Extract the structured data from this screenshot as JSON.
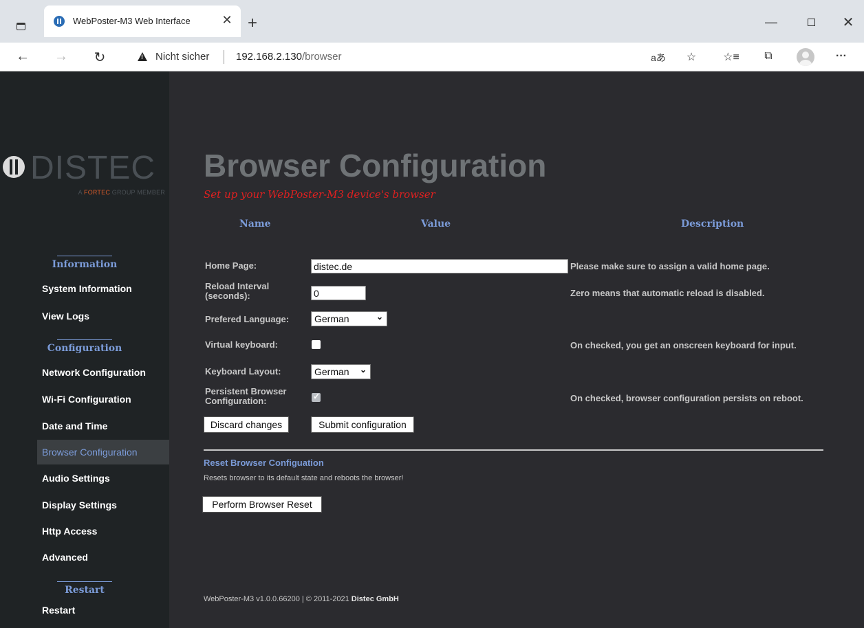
{
  "browser": {
    "tab_title": "WebPoster-M3 Web Interface",
    "tab_close": "✕",
    "new_tab": "+",
    "security_label": "Nicht sicher",
    "url_host": "192.168.2.130",
    "url_path": "/browser",
    "icons": [
      "window-icon",
      "favicon",
      "back-icon",
      "forward-icon",
      "reload-icon",
      "warning-icon",
      "read-aloud-icon",
      "add-favorite-icon",
      "favorites-icon",
      "collections-icon",
      "profile-icon",
      "more-icon",
      "minimize-icon",
      "maximize-icon",
      "close-icon"
    ]
  },
  "logo": {
    "name": "DISTEC",
    "tagline_a": "A ",
    "tagline_b": "FORTEC",
    "tagline_c": " GROUP MEMBER"
  },
  "sidebar": {
    "section_information": "Information",
    "section_configuration": "Configuration",
    "section_restart": "Restart",
    "items": [
      {
        "label": "System Information"
      },
      {
        "label": "View Logs"
      },
      {
        "label": "Network Configuration"
      },
      {
        "label": "Wi-Fi Configuration"
      },
      {
        "label": "Date and Time"
      },
      {
        "label": "Browser Configuration",
        "active": true
      },
      {
        "label": "Audio Settings"
      },
      {
        "label": "Display Settings"
      },
      {
        "label": "Http Access"
      },
      {
        "label": "Advanced"
      },
      {
        "label": "Restart"
      }
    ]
  },
  "page": {
    "title": "Browser Configuration",
    "subtitle": "Set up your WebPoster-M3 device's browser"
  },
  "table": {
    "headers": {
      "name": "Name",
      "value": "Value",
      "description": "Description"
    }
  },
  "form": {
    "home_page": {
      "label": "Home Page:",
      "value": "distec.de",
      "description": "Please make sure to assign a valid home page."
    },
    "reload_interval": {
      "label_1": "Reload Interval",
      "label_2": "(seconds):",
      "value": "0",
      "description": "Zero means that automatic reload is disabled."
    },
    "language": {
      "label": "Prefered Language:",
      "selected": "German"
    },
    "virtual_keyboard": {
      "label": "Virtual keyboard:",
      "checked": false,
      "description": "On checked, you get an onscreen keyboard for input."
    },
    "keyboard_layout": {
      "label": "Keyboard Layout:",
      "selected": "German"
    },
    "persistent": {
      "label_1": "Persistent Browser",
      "label_2": "Configuration:",
      "checked": true,
      "description": "On checked, browser configuration persists on reboot."
    },
    "discard_label": "Discard changes",
    "submit_label": "Submit configuration"
  },
  "reset": {
    "title": "Reset Browser Configuation",
    "description": "Resets browser to its default state and reboots the browser!",
    "button_label": "Perform Browser Reset"
  },
  "footer": {
    "version": "WebPoster-M3 v1.0.0.66200 | © 2011-2021 ",
    "company": "Distec GmbH"
  },
  "colors": {
    "sidebar_bg": "#1f2325",
    "page_bg": "#2b2b2f",
    "accent_blue": "#7b9bd8",
    "subtitle_red": "#e02020",
    "logo_orange": "#d45a2a"
  }
}
